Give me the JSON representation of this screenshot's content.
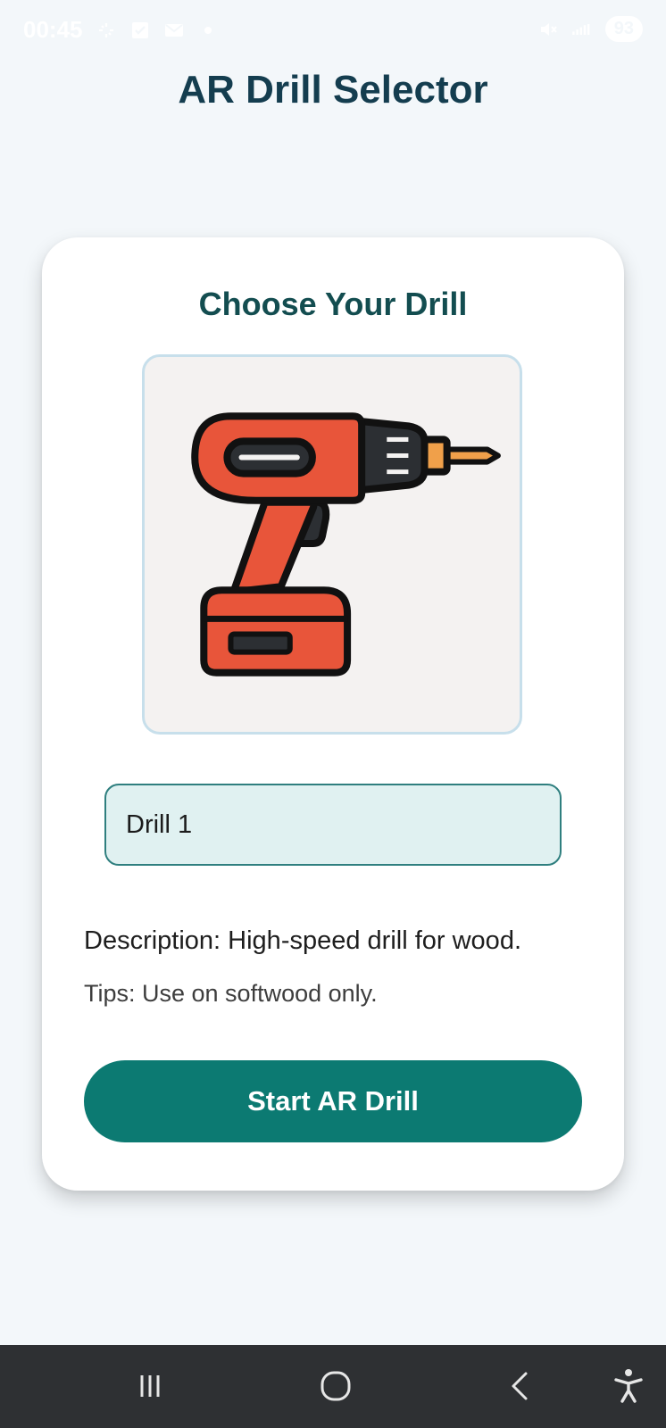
{
  "status_bar": {
    "time": "00:45",
    "battery": "93",
    "icons": [
      "sync-icon",
      "check-icon",
      "mail-icon",
      "dot-icon",
      "mute-icon",
      "signal-icon"
    ]
  },
  "app": {
    "title": "AR Drill Selector"
  },
  "card": {
    "heading": "Choose Your Drill",
    "image_icon": "drill-illustration",
    "selected_drill": "Drill 1",
    "description": "Description: High-speed drill for wood.",
    "tips": "Tips: Use on softwood only.",
    "start_button_label": "Start AR Drill"
  },
  "nav_bar": {
    "buttons": [
      "recents-icon",
      "home-icon",
      "back-icon",
      "accessibility-icon"
    ]
  },
  "colors": {
    "title": "#143d4f",
    "heading": "#134d50",
    "accent": "#0c7a72",
    "select_bg": "#e0f1f1",
    "drill_body": "#e8553a",
    "nav_bar": "#2e3033"
  }
}
